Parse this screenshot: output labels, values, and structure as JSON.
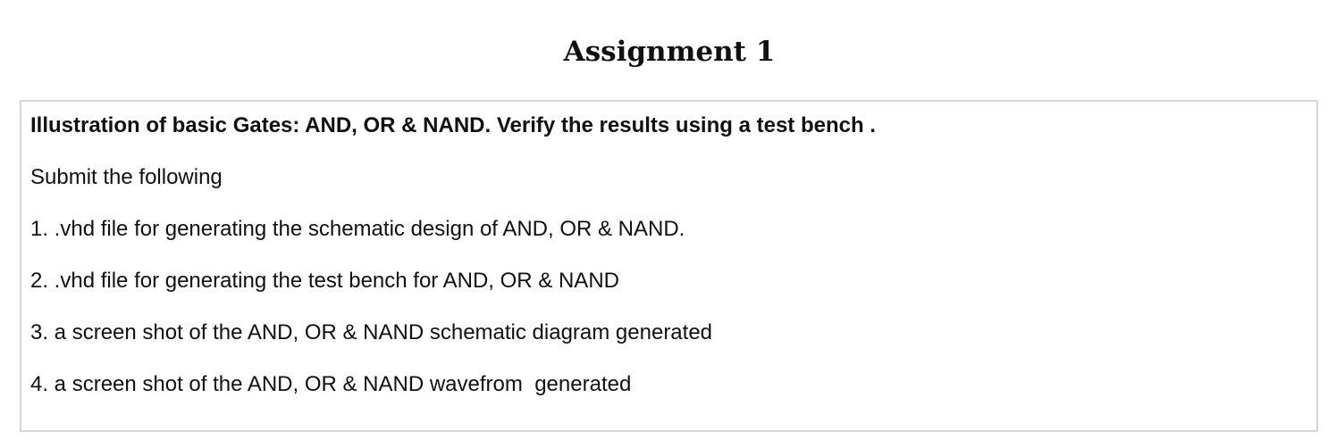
{
  "page": {
    "title": "Assignment 1"
  },
  "assignment": {
    "intro": "Illustration of basic Gates: AND, OR & NAND. Verify the results using a test bench .",
    "submit_heading": "Submit the following",
    "items": [
      "1. .vhd file for generating the schematic design of AND, OR & NAND.",
      "2. .vhd file for generating the test bench for AND, OR & NAND",
      "3. a screen shot of the AND, OR & NAND schematic diagram generated",
      "4. a screen shot of the AND, OR & NAND wavefrom  generated"
    ]
  }
}
